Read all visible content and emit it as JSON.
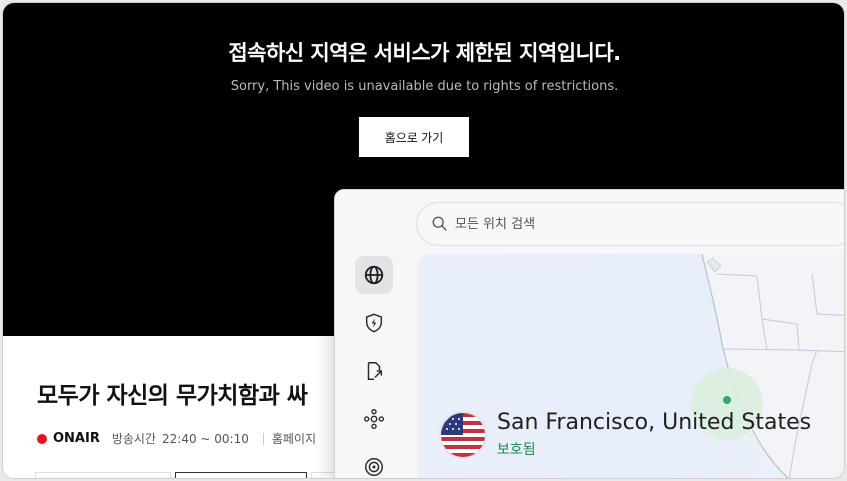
{
  "player": {
    "message_ko": "접속하신 지역은 서비스가 제한된 지역입니다.",
    "message_en": "Sorry, This video is unavailable due to rights of restrictions.",
    "home_button": "홈으로 가기"
  },
  "program": {
    "title": "모두가 자신의 무가치함과 싸",
    "onair": "ONAIR",
    "air_time_label": "방송시간",
    "air_time": "22:40 ~ 00:10",
    "homepage_label": "홈페이지"
  },
  "vpn": {
    "search_placeholder": "모든 위치 검색",
    "rail_icons": [
      "globe-icon",
      "shield-bolt-icon",
      "file-share-icon",
      "meshnet-icon",
      "radar-icon"
    ],
    "location_name": "San Francisco, United States",
    "location_status": "보호됨",
    "colors": {
      "status": "#1f8a4f",
      "onair": "#e3141f",
      "pin": "#3aa76d"
    }
  }
}
